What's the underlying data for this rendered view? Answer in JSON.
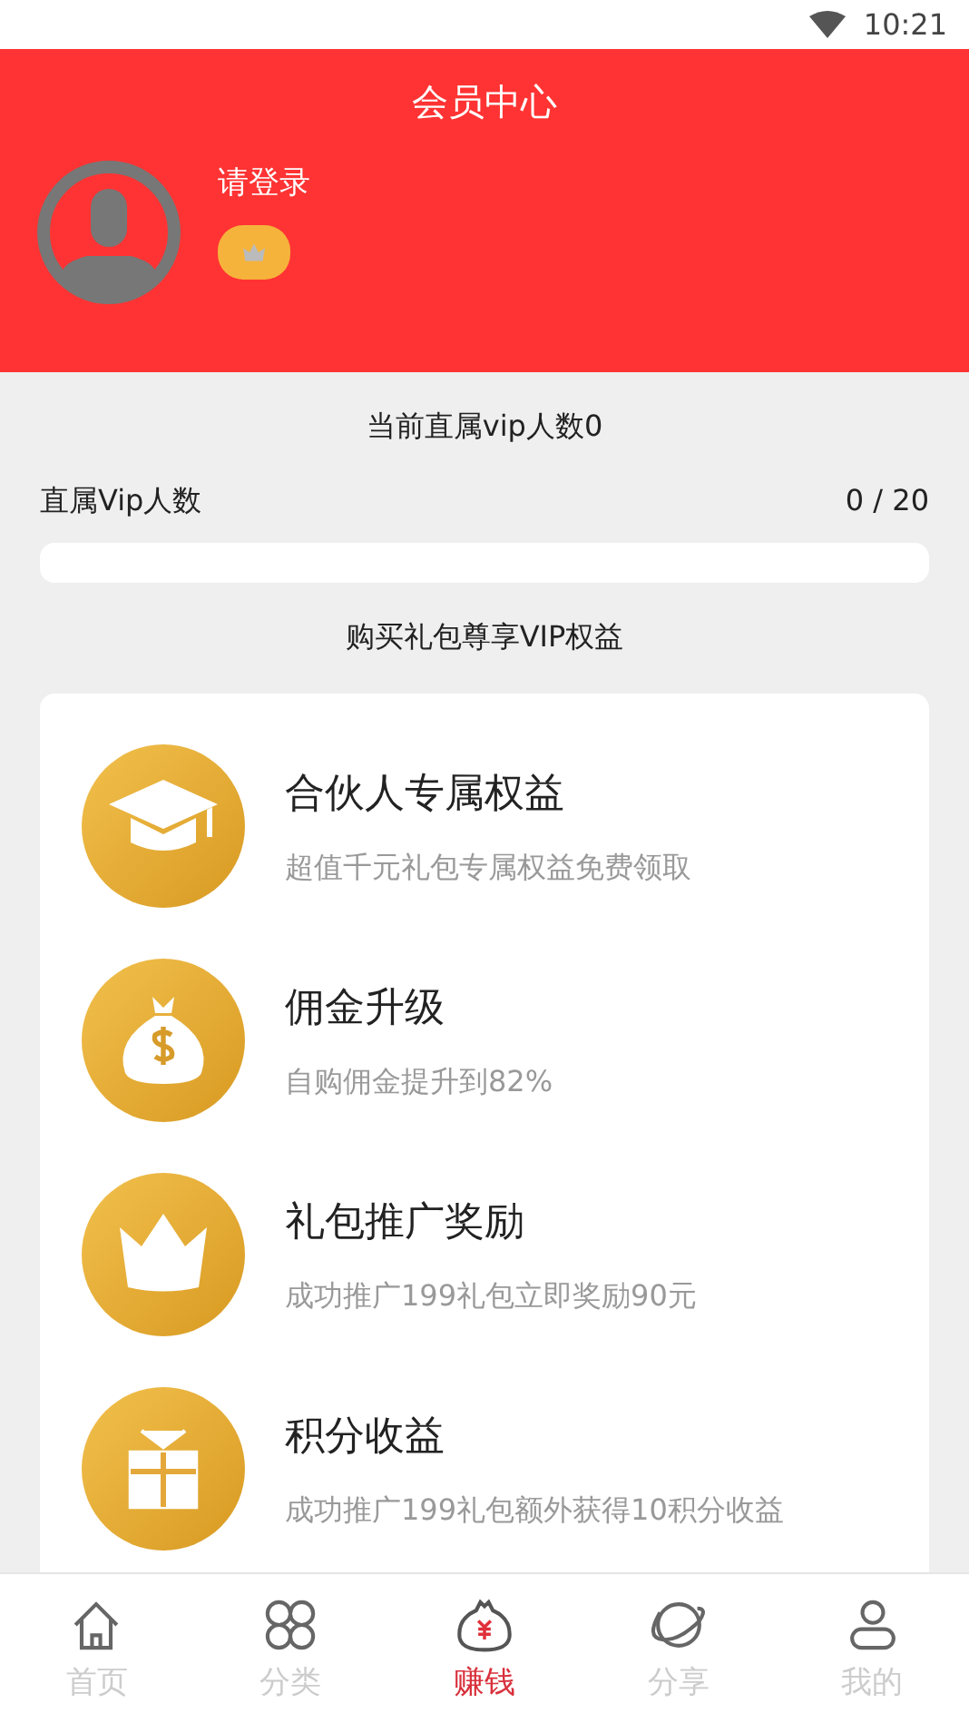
{
  "status_bar": {
    "time": "10:21"
  },
  "header": {
    "title": "会员中心",
    "login_text": "请登录"
  },
  "vip": {
    "summary": "当前直属vip人数0",
    "label": "直属Vip人数",
    "count": "0 / 20",
    "level": 0
  },
  "section_title": "购买礼包尊享VIP权益",
  "benefits": [
    {
      "title": "合伙人专属权益",
      "subtitle": "超值千元礼包专属权益免费领取"
    },
    {
      "title": "佣金升级",
      "subtitle": "自购佣金提升到82%"
    },
    {
      "title": "礼包推广奖励",
      "subtitle": "成功推广199礼包立即奖励90元"
    },
    {
      "title": "积分收益",
      "subtitle": "成功推广199礼包额外获得10积分收益"
    }
  ],
  "tabs": [
    {
      "label": "首页",
      "selected": false
    },
    {
      "label": "分类",
      "selected": false
    },
    {
      "label": "赚钱",
      "selected": true
    },
    {
      "label": "分享",
      "selected": false
    },
    {
      "label": "我的",
      "selected": false
    }
  ]
}
